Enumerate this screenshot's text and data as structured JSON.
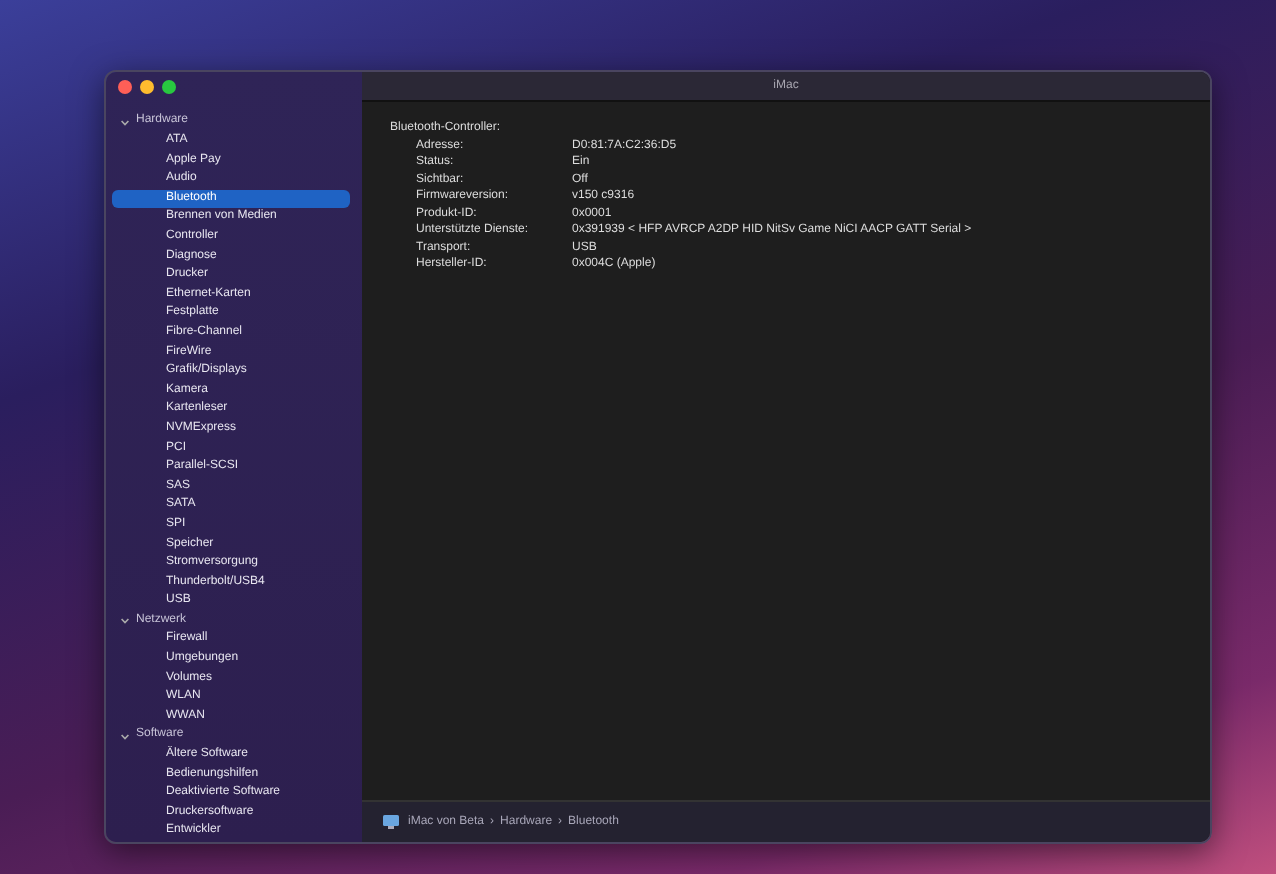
{
  "window": {
    "title": "iMac"
  },
  "sidebar": {
    "items": [
      {
        "label": "Hardware",
        "expanded": true,
        "selected": false,
        "children": [
          {
            "label": "ATA",
            "selected": false
          },
          {
            "label": "Apple Pay",
            "selected": false
          },
          {
            "label": "Audio",
            "selected": false
          },
          {
            "label": "Bluetooth",
            "selected": true
          },
          {
            "label": "Brennen von Medien",
            "selected": false
          },
          {
            "label": "Controller",
            "selected": false
          },
          {
            "label": "Diagnose",
            "selected": false
          },
          {
            "label": "Drucker",
            "selected": false
          },
          {
            "label": "Ethernet-Karten",
            "selected": false
          },
          {
            "label": "Festplatte",
            "selected": false
          },
          {
            "label": "Fibre-Channel",
            "selected": false
          },
          {
            "label": "FireWire",
            "selected": false
          },
          {
            "label": "Grafik/Displays",
            "selected": false
          },
          {
            "label": "Kamera",
            "selected": false
          },
          {
            "label": "Kartenleser",
            "selected": false
          },
          {
            "label": "NVMExpress",
            "selected": false
          },
          {
            "label": "PCI",
            "selected": false
          },
          {
            "label": "Parallel-SCSI",
            "selected": false
          },
          {
            "label": "SAS",
            "selected": false
          },
          {
            "label": "SATA",
            "selected": false
          },
          {
            "label": "SPI",
            "selected": false
          },
          {
            "label": "Speicher",
            "selected": false
          },
          {
            "label": "Stromversorgung",
            "selected": false
          },
          {
            "label": "Thunderbolt/USB4",
            "selected": false
          },
          {
            "label": "USB",
            "selected": false
          }
        ]
      },
      {
        "label": "Netzwerk",
        "expanded": true,
        "selected": false,
        "children": [
          {
            "label": "Firewall",
            "selected": false
          },
          {
            "label": "Umgebungen",
            "selected": false
          },
          {
            "label": "Volumes",
            "selected": false
          },
          {
            "label": "WLAN",
            "selected": false
          },
          {
            "label": "WWAN",
            "selected": false
          }
        ]
      },
      {
        "label": "Software",
        "expanded": true,
        "selected": false,
        "children": [
          {
            "label": "Ältere Software",
            "selected": false
          },
          {
            "label": "Bedienungshilfen",
            "selected": false
          },
          {
            "label": "Deaktivierte Software",
            "selected": false
          },
          {
            "label": "Druckersoftware",
            "selected": false
          },
          {
            "label": "Entwickler",
            "selected": false
          }
        ]
      }
    ]
  },
  "details": {
    "heading": "Bluetooth-Controller:",
    "rows": [
      {
        "label": "Adresse:",
        "value": "D0:81:7A:C2:36:D5"
      },
      {
        "label": "Status:",
        "value": "Ein"
      },
      {
        "label": "Sichtbar:",
        "value": "Off"
      },
      {
        "label": "Firmwareversion:",
        "value": "v150 c9316"
      },
      {
        "label": "Produkt-ID:",
        "value": "0x0001"
      },
      {
        "label": "Unterstützte Dienste:",
        "value": "0x391939 < HFP AVRCP A2DP HID NitSv Game NiCI AACP GATT Serial >"
      },
      {
        "label": "Transport:",
        "value": "USB"
      },
      {
        "label": "Hersteller-ID:",
        "value": "0x004C (Apple)"
      }
    ]
  },
  "status_bar": {
    "path": [
      "iMac von Beta",
      "Hardware",
      "Bluetooth"
    ],
    "separator": "›"
  }
}
